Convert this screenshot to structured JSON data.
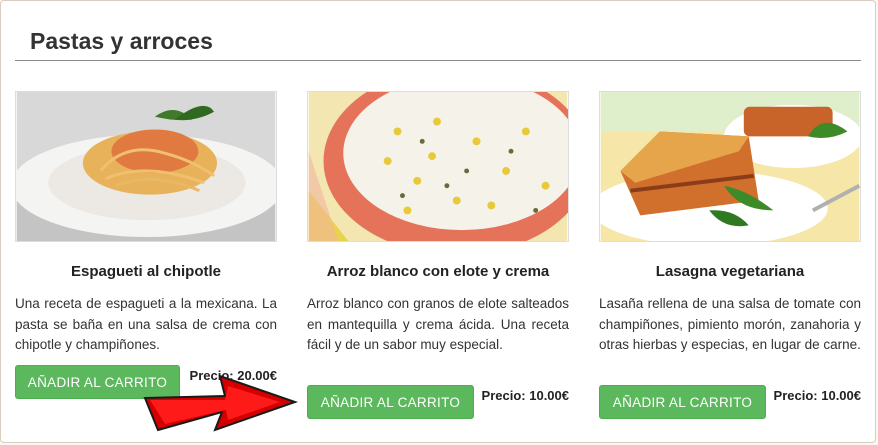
{
  "section": {
    "title": "Pastas y arroces"
  },
  "products": [
    {
      "name": "Espagueti al chipotle",
      "description": "Una receta de espagueti a la mexicana. La pasta se baña en una salsa de crema con chipotle y champiñones.",
      "button": "AÑADIR AL CARRITO",
      "price": "Precio: 20.00€"
    },
    {
      "name": "Arroz blanco con elote y crema",
      "description": "Arroz blanco con granos de elote salteados en mantequilla y crema ácida. Una receta fácil y de un sabor muy especial.",
      "button": "AÑADIR AL CARRITO",
      "price": "Precio: 10.00€"
    },
    {
      "name": "Lasagna vegetariana",
      "description": "Lasaña rellena de una salsa de tomate con champiñones, pimiento morón, zanahoria y otras hierbas y especias, en lugar de carne.",
      "button": "AÑADIR AL CARRITO",
      "price": "Precio: 10.00€"
    }
  ],
  "colors": {
    "button": "#5cb85c",
    "arrow": "#d40000"
  }
}
